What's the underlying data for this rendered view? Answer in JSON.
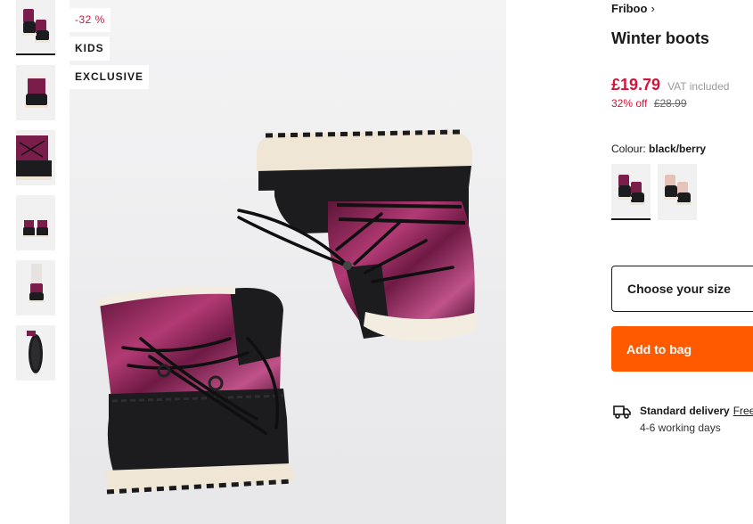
{
  "badges": {
    "discount": "-32 %",
    "kids": "KIDS",
    "exclusive": "EXCLUSIVE"
  },
  "product": {
    "brand": "Friboo",
    "brand_chevron": "›",
    "title": "Winter boots",
    "price": "£19.79",
    "vat_note": "VAT included",
    "percent_off": "32% off",
    "original_price": "£28.99"
  },
  "colour": {
    "label": "Colour:",
    "selected": "black/berry",
    "options": [
      "black/berry",
      "black/rose"
    ]
  },
  "size_select": {
    "placeholder": "Choose your size"
  },
  "add_to_bag": {
    "label": "Add to bag"
  },
  "delivery": {
    "title": "Standard delivery",
    "cost_link": "Free",
    "time": "4-6 working days"
  },
  "thumbnails": {
    "count": 6,
    "selected_index": 0
  },
  "colors": {
    "accent": "#ff5a00",
    "sale_red": "#d0143c",
    "text": "#1a1a1a",
    "boot_black": "#1c1c1e",
    "boot_berry": "#7a1d4a",
    "sole_cream": "#efe6d6"
  }
}
